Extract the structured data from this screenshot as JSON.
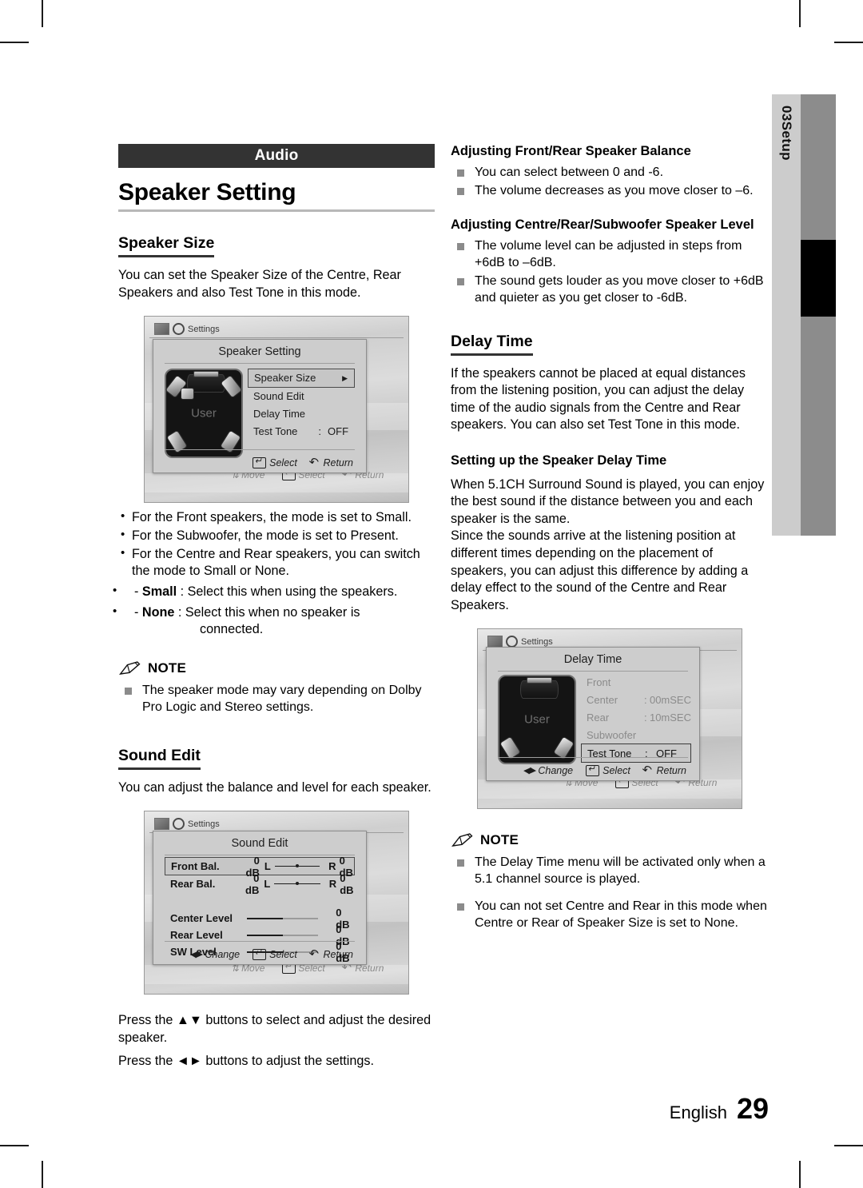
{
  "section": {
    "banner": "Audio",
    "title": "Speaker Setting"
  },
  "sidebar": {
    "number": "03",
    "label": "Setup"
  },
  "footer": {
    "language": "English",
    "page": "29"
  },
  "left": {
    "speaker_size": {
      "heading": "Speaker Size",
      "intro": "You can set the Speaker Size of the Centre, Rear Speakers and also Test Tone in this mode.",
      "bullets": [
        "For the Front speakers, the mode is set to Small.",
        "For the Subwoofer, the mode is set to Present.",
        "For the Centre and Rear speakers, you can switch the mode to Small or None."
      ],
      "options": [
        {
          "dash": "-",
          "term": "Small",
          "colon": ":",
          "text": "Select this when using the speakers."
        },
        {
          "dash": "-",
          "term": "None",
          "colon": ":",
          "text": "Select this when no speaker is",
          "cont": "connected."
        }
      ]
    },
    "note1": {
      "label": "NOTE",
      "items": [
        "The speaker mode may vary depending on Dolby Pro Logic and Stereo settings."
      ]
    },
    "sound_edit": {
      "heading": "Sound Edit",
      "intro": "You can adjust the balance and level for each speaker.",
      "after": [
        "Press the ▲▼ buttons to select and adjust the desired speaker.",
        "Press the ◄► buttons to adjust the settings."
      ]
    }
  },
  "right": {
    "balance": {
      "heading": "Adjusting Front/Rear Speaker Balance",
      "items": [
        "You can select between 0 and -6.",
        "The volume decreases as you move closer to –6."
      ]
    },
    "level": {
      "heading": "Adjusting Centre/Rear/Subwoofer Speaker Level",
      "items": [
        "The volume level can be adjusted in steps from +6dB to –6dB.",
        "The sound gets louder as you move closer to +6dB and quieter as you get closer to -6dB."
      ]
    },
    "delay_time": {
      "heading": "Delay Time",
      "intro": "If the speakers cannot be placed at equal distances from the listening position, you can adjust the delay time of the audio signals from the Centre and  Rear speakers. You can also set Test Tone in this mode.",
      "sub_heading": "Setting up the Speaker Delay Time",
      "para1": "When 5.1CH Surround Sound is played, you can enjoy the best sound if the distance between you and each speaker is the same.",
      "para2": "Since the sounds arrive at the listening position at different times depending on the placement of speakers, you can adjust this difference by adding a delay effect to the sound of the Centre and Rear Speakers."
    },
    "note2": {
      "label": "NOTE",
      "items": [
        "The Delay Time menu will be activated only when a 5.1 channel source is played.",
        "You can not set Centre and Rear in this mode when Centre or Rear of Speaker Size is set to None."
      ]
    }
  },
  "osd_speaker_setting": {
    "breadcrumb": "Settings",
    "dialog_title": "Speaker Setting",
    "room_label": "User",
    "rows": [
      {
        "label": "Speaker Size",
        "colon": "",
        "value": "",
        "arrow": "▶",
        "selected": true
      },
      {
        "label": "Sound Edit",
        "colon": "",
        "value": "",
        "arrow": "",
        "selected": false
      },
      {
        "label": "Delay Time",
        "colon": "",
        "value": "",
        "arrow": "",
        "selected": false
      },
      {
        "label": "Test Tone",
        "colon": ":",
        "value": "OFF",
        "arrow": "",
        "selected": false
      }
    ],
    "footer": [
      {
        "icon": "enter-icon",
        "label": "Select"
      },
      {
        "icon": "return-icon",
        "label": "Return"
      }
    ],
    "ghost_footer": [
      {
        "icon": "move-icon",
        "label": "Move"
      },
      {
        "icon": "enter-icon",
        "label": "Select"
      },
      {
        "icon": "return-icon",
        "label": "Return"
      }
    ]
  },
  "osd_sound_edit": {
    "breadcrumb": "Settings",
    "dialog_title": "Sound Edit",
    "balance_rows": [
      {
        "name": "Front  Bal.",
        "db": "0 dB",
        "left": "L",
        "right": "R",
        "right_db": "0 dB",
        "selected": true
      },
      {
        "name": "Rear  Bal.",
        "db": "0 dB",
        "left": "L",
        "right": "R",
        "right_db": "0 dB",
        "selected": false
      }
    ],
    "level_rows": [
      {
        "name": "Center  Level",
        "value": "0 dB"
      },
      {
        "name": "Rear  Level",
        "value": "0 dB"
      },
      {
        "name": "SW  Level",
        "value": "0 dB"
      }
    ],
    "footer": [
      {
        "icon": "left-right-icon",
        "label": "Change"
      },
      {
        "icon": "enter-icon",
        "label": "Select"
      },
      {
        "icon": "return-icon",
        "label": "Return"
      }
    ],
    "ghost_footer": [
      {
        "icon": "move-icon",
        "label": "Move"
      },
      {
        "icon": "enter-icon",
        "label": "Select"
      },
      {
        "icon": "return-icon",
        "label": "Return"
      }
    ]
  },
  "osd_delay_time": {
    "breadcrumb": "Settings",
    "dialog_title": "Delay Time",
    "room_label": "User",
    "rows": [
      {
        "label": "Front",
        "colon": "",
        "value": "",
        "active": false
      },
      {
        "label": "Center",
        "colon": ":",
        "value": "00mSEC",
        "active": false
      },
      {
        "label": "Rear",
        "colon": ":",
        "value": "10mSEC",
        "active": false
      },
      {
        "label": "Subwoofer",
        "colon": "",
        "value": "",
        "active": false
      },
      {
        "label": "Test Tone",
        "colon": ":",
        "value": "OFF",
        "active": true
      }
    ],
    "footer": [
      {
        "icon": "left-right-icon",
        "label": "Change"
      },
      {
        "icon": "enter-icon",
        "label": "Select"
      },
      {
        "icon": "return-icon",
        "label": "Return"
      }
    ],
    "ghost_footer": [
      {
        "icon": "move-icon",
        "label": "Move"
      },
      {
        "icon": "enter-icon",
        "label": "Select"
      },
      {
        "icon": "return-icon",
        "label": "Return"
      }
    ]
  }
}
